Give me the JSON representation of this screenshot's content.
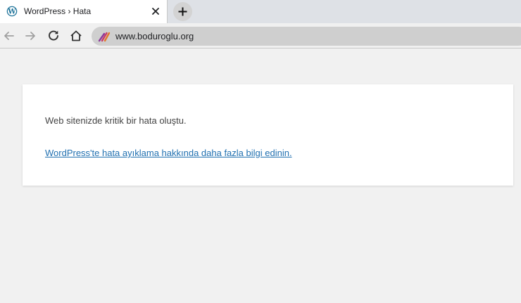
{
  "tab": {
    "title": "WordPress › Hata",
    "favicon": "wordpress-logo-icon",
    "close_icon": "close-icon"
  },
  "new_tab_icon": "plus-icon",
  "toolbar": {
    "back_icon": "arrow-left-icon",
    "forward_icon": "arrow-right-icon",
    "reload_icon": "reload-icon",
    "home_icon": "home-icon",
    "site_icon": "site-info-icon",
    "url": "www.boduroglu.org"
  },
  "page": {
    "message": "Web sitenizde kritik bir hata oluştu.",
    "link_text": "WordPress'te hata ayıklama hakkında daha fazla bilgi edinin."
  },
  "colors": {
    "link": "#2271b1",
    "text": "#444444",
    "background": "#f1f1f1"
  }
}
